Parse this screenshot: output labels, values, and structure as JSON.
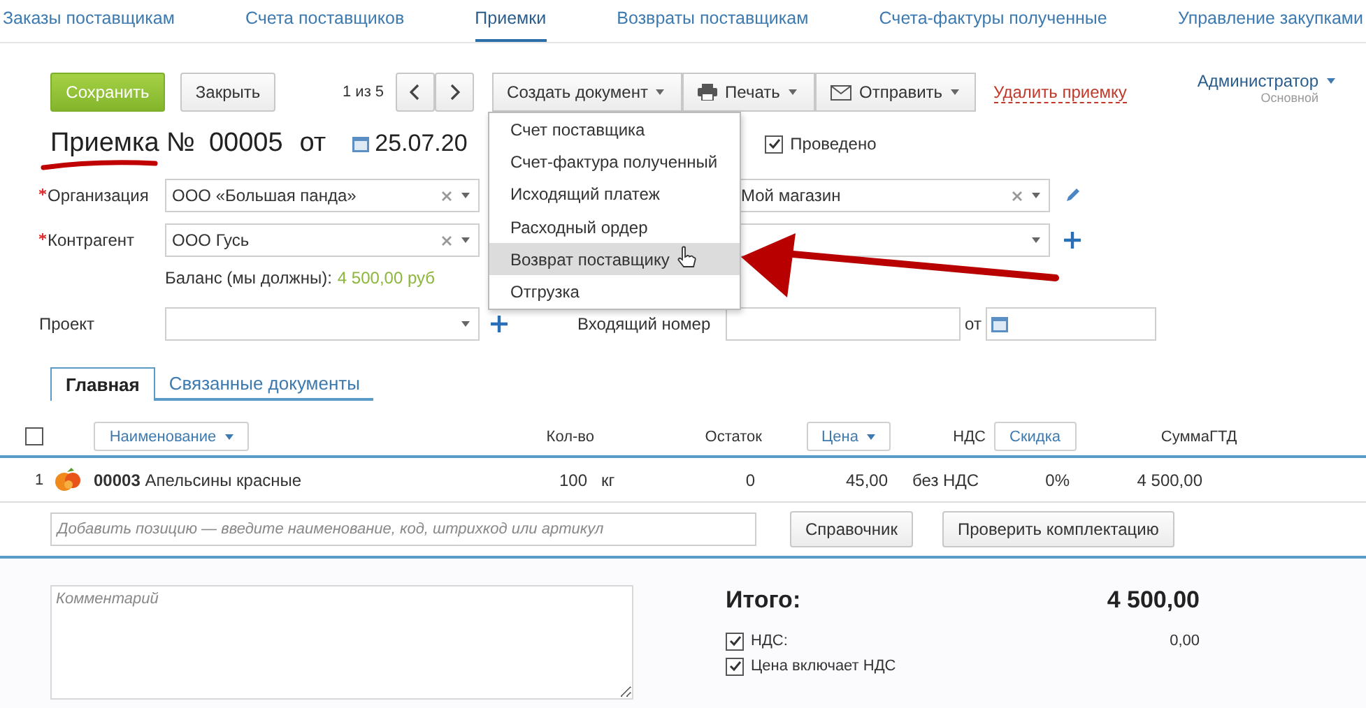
{
  "nav_tabs": [
    {
      "label": "Заказы поставщикам",
      "selected": false
    },
    {
      "label": "Счета поставщиков",
      "selected": false
    },
    {
      "label": "Приемки",
      "selected": true
    },
    {
      "label": "Возвраты поставщикам",
      "selected": false
    },
    {
      "label": "Счета-фактуры полученные",
      "selected": false
    },
    {
      "label": "Управление закупками",
      "selected": false
    }
  ],
  "toolbar": {
    "save": "Сохранить",
    "close": "Закрыть",
    "pager": "1 из 5",
    "create": "Создать документ",
    "print": "Печать",
    "send": "Отправить",
    "delete": "Удалить приемку",
    "user": {
      "name": "Администратор",
      "role": "Основной"
    }
  },
  "document": {
    "title": "Приемка №",
    "number": "00005",
    "from": "от",
    "date": "25.07.20",
    "posted": {
      "label": "Проведено",
      "checked": true
    }
  },
  "create_menu": {
    "items": [
      {
        "label": "Счет поставщика",
        "selected": false
      },
      {
        "label": "Счет-фактура полученный",
        "selected": false
      },
      {
        "label": "Исходящий платеж",
        "selected": false
      },
      {
        "label": "Расходный ордер",
        "selected": false
      },
      {
        "label": "Возврат поставщику",
        "selected": true
      },
      {
        "label": "Отгрузка",
        "selected": false
      }
    ]
  },
  "organization": {
    "label": "Организация",
    "required": true,
    "value": "ООО «Большая панда»"
  },
  "warehouse": {
    "value": "Мой магазин"
  },
  "counterparty": {
    "label": "Контрагент",
    "required": true,
    "value": "ООО Гусь"
  },
  "balance": {
    "label": "Баланс (мы должны):",
    "amount": "4 500,00 руб"
  },
  "project": {
    "label": "Проект",
    "required": false
  },
  "incoming_number": {
    "label": "Входящий номер",
    "from": "от"
  },
  "doc_tabs": [
    {
      "label": "Главная",
      "selected": true
    },
    {
      "label": "Связанные документы",
      "selected": false
    }
  ],
  "table": {
    "select_all": {
      "checked": false
    },
    "columns": [
      {
        "label": "Наименование",
        "kind": "dropdown"
      },
      {
        "label": "Кол-во",
        "kind": "text"
      },
      {
        "label": "Остаток",
        "kind": "text"
      },
      {
        "label": "Цена",
        "kind": "dropdown"
      },
      {
        "label": "НДС",
        "kind": "text"
      },
      {
        "label": "Скидка",
        "kind": "button"
      },
      {
        "label": "Сумма",
        "kind": "text"
      },
      {
        "label": "ГТД",
        "kind": "text"
      }
    ],
    "rows": [
      {
        "index": "1",
        "name": "**00003** Апельсины красные",
        "qty": "100",
        "unit": "кг",
        "stock": "0",
        "price": "45,00",
        "vat": "без НДС",
        "discount": "0%",
        "sum": "4 500,00"
      }
    ]
  },
  "add_row": {
    "placeholder": "Добавить позицию — введите наименование, код, штрихкод или артикул",
    "buttons": [
      "Справочник",
      "Проверить комплектацию"
    ]
  },
  "comment": {
    "placeholder": "Комментарий"
  },
  "totals": {
    "label": "Итого:",
    "value": "4 500,00",
    "options": [
      {
        "label": "НДС:",
        "checked": true,
        "value": "0,00"
      },
      {
        "label": "Цена включает НДС",
        "checked": true
      }
    ]
  }
}
